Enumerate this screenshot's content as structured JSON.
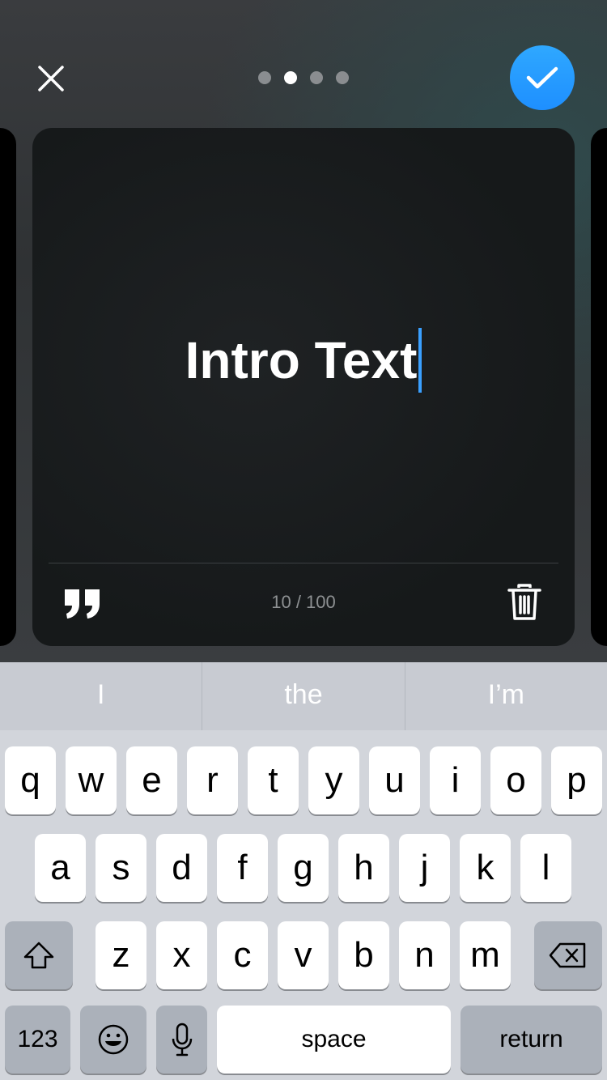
{
  "colors": {
    "accent": "#1e8fff",
    "caret": "#3aa0ff",
    "card_bg": "#16191a",
    "keyboard_bg": "#d2d5db"
  },
  "pager": {
    "count": 4,
    "active_index": 1
  },
  "editor": {
    "text": "Intro Text",
    "char_count": "10 / 100"
  },
  "suggestions": [
    "I",
    "the",
    "I’m"
  ],
  "keyboard": {
    "row1": [
      "q",
      "w",
      "e",
      "r",
      "t",
      "y",
      "u",
      "i",
      "o",
      "p"
    ],
    "row2": [
      "a",
      "s",
      "d",
      "f",
      "g",
      "h",
      "j",
      "k",
      "l"
    ],
    "row3": [
      "z",
      "x",
      "c",
      "v",
      "b",
      "n",
      "m"
    ],
    "numbers_label": "123",
    "space_label": "space",
    "return_label": "return"
  },
  "icons": {
    "close": "close-icon",
    "confirm": "checkmark-icon",
    "quote": "quote-icon",
    "trash": "trash-icon",
    "shift": "shift-icon",
    "delete": "backspace-icon",
    "emoji": "emoji-icon",
    "mic": "microphone-icon"
  }
}
